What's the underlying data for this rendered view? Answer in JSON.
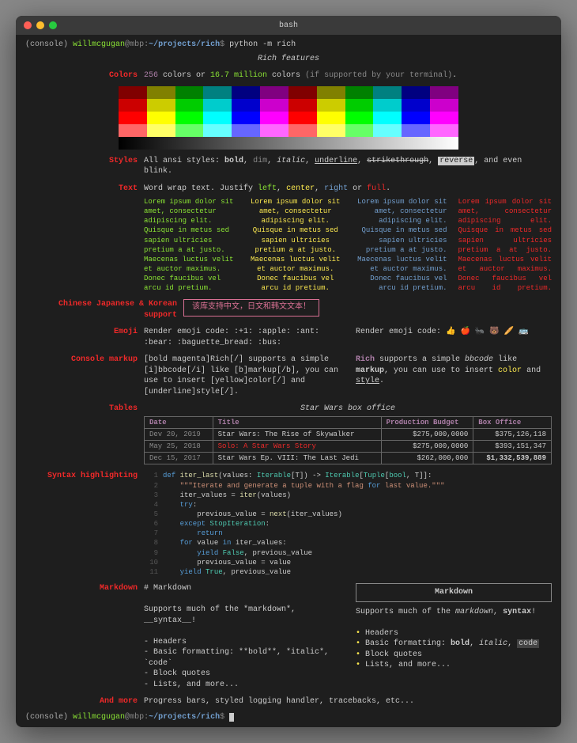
{
  "window": {
    "title": "bash"
  },
  "prompt": {
    "console": "(console)",
    "user": "willmcgugan",
    "at": "@",
    "host": "mbp",
    "sep": ":",
    "path": "~/projects/rich",
    "sigil": "$",
    "cmd": "python -m rich"
  },
  "header": "Rich features",
  "colors": {
    "label": "Colors",
    "pre": "256",
    "mid1": " colors or ",
    "num2": "16.7 million",
    "mid2": " colors ",
    "paren": "(if supported by your terminal)",
    "dot": "."
  },
  "styles": {
    "label": "Styles",
    "pre": "All ansi styles: ",
    "bold": "bold",
    "c1": ", ",
    "dim": "dim",
    "c2": ", ",
    "italic": "italic",
    "c3": ", ",
    "underline": "underline",
    "c4": ", ",
    "strike": "strikethrough",
    "c5": ", ",
    "reverse": "reverse",
    "c6": ", and even blink."
  },
  "text": {
    "label": "Text",
    "pre": "Word wrap text. Justify ",
    "left": "left",
    "c1": ", ",
    "center": "center",
    "c2": ", ",
    "right": "right",
    "c3": " or ",
    "full": "full",
    "dot": "."
  },
  "lorem": "Lorem ipsum dolor sit amet, consectetur adipiscing elit. Quisque in metus sed sapien ultricies pretium a at justo. Maecenas luctus velit et auctor maximus. Donec faucibus vel arcu id pretium.",
  "cjk": {
    "label": "Chinese Japanese & Korean support",
    "text": "该库支持中文，日文和韩文文本！"
  },
  "emoji": {
    "label": "Emoji",
    "left": "Render emoji code: :+1: :apple: :ant: :bear: :baguette_bread: :bus:",
    "right_pre": "Render emoji code: ",
    "right_glyphs": "👍 🍎 🐜 🐻 🥖 🚌"
  },
  "markup": {
    "label": "Console markup",
    "left_1": "[bold magenta]Rich[/]",
    "left_2": " supports a simple ",
    "left_3": "[i]bbcode[/i]",
    "left_4": " like ",
    "left_5": "[b]markup[/b]",
    "left_6": ", you can use to insert ",
    "left_7": "[yellow]color[/]",
    "left_8": " and ",
    "left_9": "[underline]style[/]",
    "left_10": ".",
    "r_rich": "Rich",
    "r_1": " supports a simple ",
    "r_bb": "bbcode",
    "r_2": " like ",
    "r_mk": "markup",
    "r_3": ", you can use to insert ",
    "r_color": "color",
    "r_4": " and ",
    "r_style": "style",
    "r_5": "."
  },
  "tables": {
    "label": "Tables",
    "caption": "Star Wars box office",
    "headers": [
      "Date",
      "Title",
      "Production Budget",
      "Box Office"
    ],
    "rows": [
      [
        "Dev 20, 2019",
        "Star Wars: The Rise of Skywalker",
        "$275,000,0000",
        "$375,126,118"
      ],
      [
        "May 25, 2018",
        "Solo: A Star Wars Story",
        "$275,000,0000",
        "$393,151,347"
      ],
      [
        "Dec 15, 2017",
        "Star Wars Ep. VIII: The Last Jedi",
        "$262,000,000",
        "$1,332,539,889"
      ]
    ]
  },
  "syntax": {
    "label": "Syntax highlighting",
    "lines": [
      "def iter_last(values: Iterable[T]) -> Iterable[Tuple[bool, T]]:",
      "    \"\"\"Iterate and generate a tuple with a flag for last value.\"\"\"",
      "    iter_values = iter(values)",
      "    try:",
      "        previous_value = next(iter_values)",
      "    except StopIteration:",
      "        return",
      "    for value in iter_values:",
      "        yield False, previous_value",
      "        previous_value = value",
      "    yield True, previous_value"
    ]
  },
  "markdown": {
    "label": "Markdown",
    "left_h": "# Markdown",
    "left_p": "Supports much of the *markdown*, __syntax__!",
    "left_items": [
      "- Headers",
      "- Basic formatting: **bold**, *italic*, `code`",
      "- Block quotes",
      "- Lists, and more..."
    ],
    "right_title": "Markdown",
    "right_p_pre": "Supports much of the ",
    "right_p_md": "markdown",
    "right_p_mid": ", ",
    "right_p_sy": "syntax",
    "right_p_end": "!",
    "right_items_pre": [
      "Headers",
      "Basic formatting: ",
      "Block quotes",
      "Lists, and more..."
    ],
    "right_bold": "bold",
    "right_c1": ", ",
    "right_italic": "italic",
    "right_c2": ", ",
    "right_code": "code"
  },
  "more": {
    "label": "And more",
    "text": "Progress bars, styled logging handler, tracebacks, etc..."
  }
}
